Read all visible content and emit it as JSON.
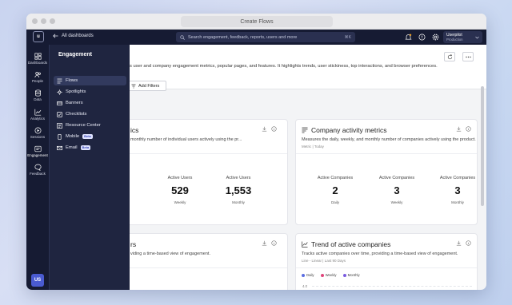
{
  "browser": {
    "url_title": "Create Flows"
  },
  "topnav": {
    "logo": "u",
    "back_label": "All dashboards",
    "search_placeholder": "Search engagement, feedback, reports, users and more",
    "search_shortcut": "⌘K",
    "account_name": "Userpilot",
    "account_env": "Production"
  },
  "rail": {
    "items": [
      {
        "label": "Dashboards",
        "icon": "dashboard-icon"
      },
      {
        "label": "People",
        "icon": "people-icon"
      },
      {
        "label": "Data",
        "icon": "database-icon"
      },
      {
        "label": "Analytics",
        "icon": "analytics-icon"
      },
      {
        "label": "Sessions",
        "icon": "play-icon"
      },
      {
        "label": "Engagement",
        "icon": "engagement-icon"
      },
      {
        "label": "Feedback",
        "icon": "feedback-icon"
      }
    ],
    "avatar": "US"
  },
  "flyout": {
    "heading": "Engagement",
    "items": [
      {
        "label": "Flows",
        "badge": ""
      },
      {
        "label": "Spotlights",
        "badge": ""
      },
      {
        "label": "Banners",
        "badge": ""
      },
      {
        "label": "Checklists",
        "badge": ""
      },
      {
        "label": "Resource Center",
        "badge": ""
      },
      {
        "label": "Mobile",
        "badge": "Beta"
      },
      {
        "label": "Email",
        "badge": "Beta"
      }
    ]
  },
  "main": {
    "description": "s user and company engagement metrics, popular pages, and features. It highlights trends, user stickiness, top interactions, and browser preferences.",
    "add_filters": "Add Filters",
    "cards": {
      "user_activity": {
        "title": "ics",
        "sub": "monthly number of individual users actively using the pr...",
        "metrics": [
          {
            "label": "Active Users",
            "value": "529",
            "period": "Weekly"
          },
          {
            "label": "Active Users",
            "value": "1,553",
            "period": "Monthly"
          }
        ]
      },
      "company_activity": {
        "title": "Company activity metrics",
        "sub": "Measures the daily, weekly, and monthly number of companies actively using the product.",
        "meta": "Metric | Today",
        "metrics": [
          {
            "label": "Active Companies",
            "value": "2",
            "period": "Daily"
          },
          {
            "label": "Active Companies",
            "value": "3",
            "period": "Weekly"
          },
          {
            "label": "Active Companies",
            "value": "3",
            "period": "Monthly"
          }
        ]
      },
      "user_trend": {
        "title": "rs",
        "sub": "viding a time-based view of engagement."
      },
      "company_trend": {
        "title": "Trend of active companies",
        "sub": "Tracks active companies over time, providing a time-based view of engagement.",
        "meta": "Line - Linear | Last 90 Days",
        "legend": [
          "Daily",
          "Weekly",
          "Monthly"
        ],
        "legend_colors": [
          "#5b6ee1",
          "#e0457b",
          "#7b5ce0"
        ],
        "y_tick": "4.0"
      }
    }
  },
  "colors": {
    "nav": "#161b33",
    "flyout": "#1f2540",
    "accent": "#4a5bd0"
  }
}
